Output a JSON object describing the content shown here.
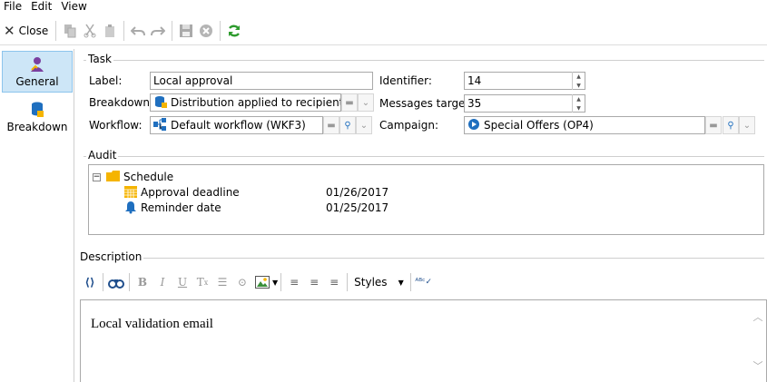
{
  "menu": {
    "file": "File",
    "edit": "Edit",
    "view": "View"
  },
  "toolbar": {
    "close_label": "Close"
  },
  "nav": {
    "general": "General",
    "breakdown": "Breakdown"
  },
  "task": {
    "group_label": "Task",
    "label_lbl": "Label:",
    "label_value": "Local approval",
    "breakdown_lbl": "Breakdown:",
    "breakdown_value": "Distribution applied to recipients",
    "workflow_lbl": "Workflow:",
    "workflow_value": "Default workflow (WKF3)",
    "identifier_lbl": "Identifier:",
    "identifier_value": "14",
    "messages_target_lbl": "Messages target:",
    "messages_target_value": "35",
    "campaign_lbl": "Campaign:",
    "campaign_value": "Special Offers (OP4)"
  },
  "audit": {
    "group_label": "Audit",
    "folder": "Schedule",
    "rows": [
      {
        "label": "Approval deadline",
        "date": "01/26/2017"
      },
      {
        "label": "Reminder date",
        "date": "01/25/2017"
      }
    ]
  },
  "description": {
    "group_label": "Description",
    "styles_label": "Styles",
    "content": "Local validation email"
  },
  "colors": {
    "accent": "#cde6f7",
    "refresh": "#2e9b2e",
    "folder": "#f5b400",
    "navy": "#1f4e8c"
  }
}
